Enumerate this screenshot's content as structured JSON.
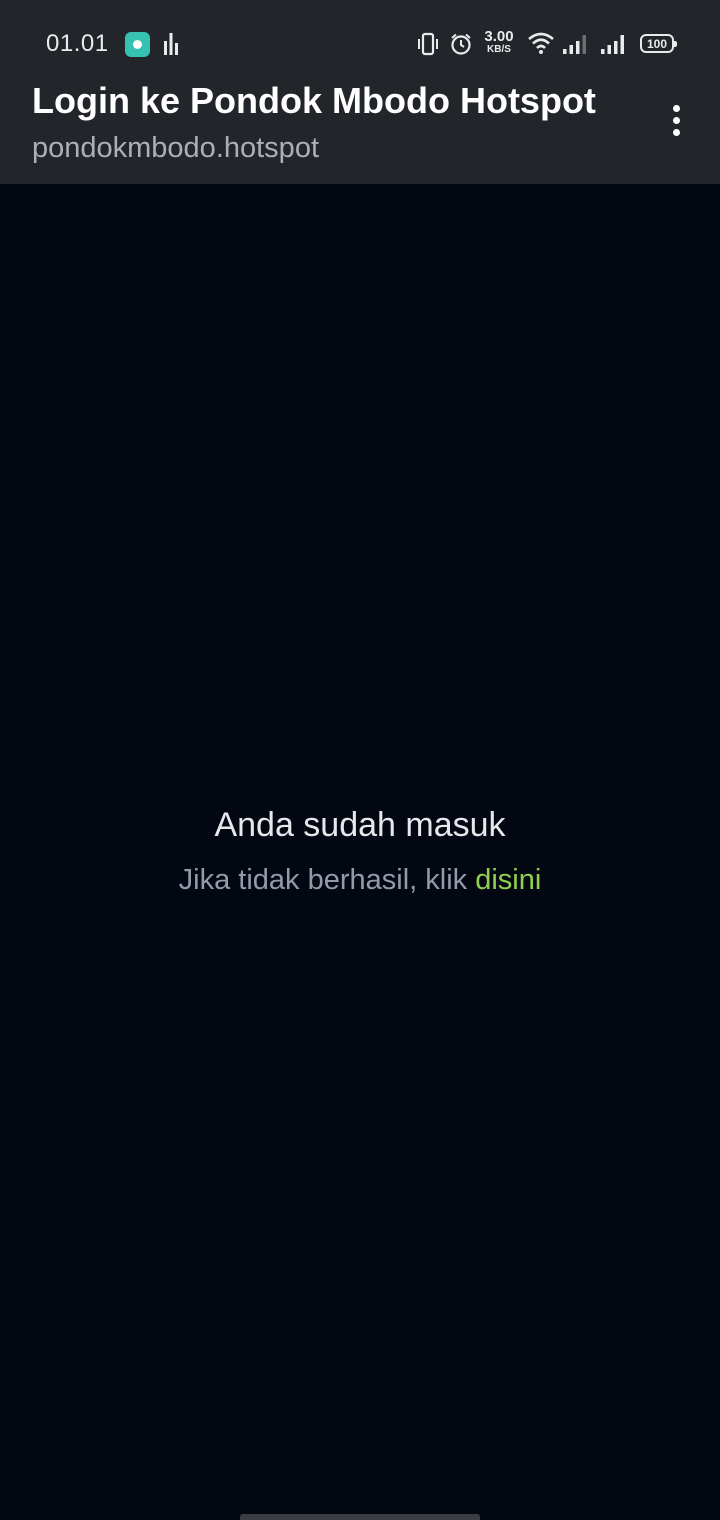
{
  "status_bar": {
    "time": "01.01",
    "net_speed_value": "3.00",
    "net_speed_unit": "KB/S",
    "battery": "100",
    "icons": [
      "app-notification-icon",
      "equalizer-icon",
      "vibrate-icon",
      "alarm-icon",
      "wifi-icon",
      "signal-icon",
      "signal-icon",
      "battery-icon"
    ]
  },
  "header": {
    "title": "Login ke Pondok Mbodo Hotspot",
    "url": "pondokmbodo.hotspot",
    "menu_icon": "more-vert-icon"
  },
  "content": {
    "message_title": "Anda sudah masuk",
    "message_prefix": "Jika tidak berhasil, klik ",
    "link_text": "disini"
  },
  "colors": {
    "header_bg": "#22262a",
    "page_bg": "#030711",
    "link": "#8fd14f"
  }
}
